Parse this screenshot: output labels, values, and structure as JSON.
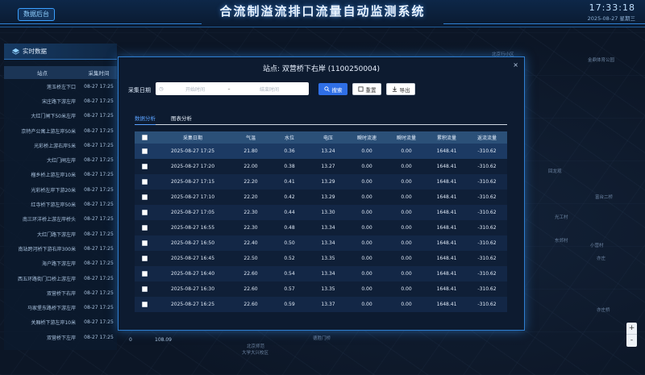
{
  "header": {
    "title": "合流制溢流排口流量自动监测系统",
    "back_label": "数据后台",
    "time": "17:33:18",
    "date": "2025-08-27 星期三"
  },
  "map_labels": [
    "金鼎体育公园",
    "北京体育",
    "大学木棉路",
    "北京师范",
    "大学大兴校区",
    "回龙观",
    "富台二桥",
    "光工村",
    "东郊村",
    "小营村",
    "亦庄",
    "亦庄桥",
    "北京行小区",
    "阳台中心",
    "德胜门桥"
  ],
  "realtime": {
    "title": "实时数据",
    "col_station": "站点",
    "col_time": "采集时间",
    "rows": [
      {
        "station": "莲玉桥左下口",
        "time": "08-27 17:25"
      },
      {
        "station": "宋庄路下游左岸",
        "time": "08-27 17:25"
      },
      {
        "station": "大红门闸下50米左岸",
        "time": "08-27 17:25"
      },
      {
        "station": "京特产公寓上游左岸50米",
        "time": "08-27 17:25"
      },
      {
        "station": "光彩桥上游右岸5米",
        "time": "08-27 17:25"
      },
      {
        "station": "大红门闸左岸",
        "time": "08-27 17:25"
      },
      {
        "station": "榴乡桥上游左岸10米",
        "time": "08-27 17:25"
      },
      {
        "station": "光彩桥左岸下游20米",
        "time": "08-27 17:25"
      },
      {
        "station": "红寺桥下游左岸50米",
        "time": "08-27 17:25"
      },
      {
        "station": "南三环洋桥上游左岸桥头",
        "time": "08-27 17:25"
      },
      {
        "station": "大红门路下游左岸",
        "time": "08-27 17:25"
      },
      {
        "station": "南站跨河桥下游右岸300米",
        "time": "08-27 17:25"
      },
      {
        "station": "海户路下游左岸",
        "time": "08-27 17:25"
      },
      {
        "station": "西五环路街门口桥上游左岸",
        "time": "08-27 17:25"
      },
      {
        "station": "双营桥下右岸",
        "time": "08-27 17:25"
      },
      {
        "station": "马家堡东路桥下游左岸",
        "time": "08-27 17:25"
      },
      {
        "station": "关厢桥下游左岸10米",
        "time": "08-27 17:25"
      },
      {
        "station": "双营桥下左岸",
        "time": "08-27 17:25"
      }
    ],
    "stray_values": [
      "0",
      "108.09"
    ]
  },
  "modal": {
    "title": "站点: 双营桥下右岸 (1100250004)",
    "close_glyph": "×",
    "filter_label": "采集日期",
    "start_placeholder": "开始时间",
    "range_sep": "–",
    "end_placeholder": "结束时间",
    "search_label": "搜索",
    "reset_label": "重置",
    "export_label": "导出",
    "tabs": [
      "数据分析",
      "图表分析"
    ],
    "columns": [
      "采集日期",
      "气温",
      "水位",
      "电压",
      "瞬时流速",
      "瞬时流量",
      "累积流量",
      "返流流量"
    ],
    "rows": [
      [
        "2025-08-27 17:25",
        "21.80",
        "0.36",
        "13.24",
        "0.00",
        "0.00",
        "1648.41",
        "-310.62"
      ],
      [
        "2025-08-27 17:20",
        "22.00",
        "0.38",
        "13.27",
        "0.00",
        "0.00",
        "1648.41",
        "-310.62"
      ],
      [
        "2025-08-27 17:15",
        "22.20",
        "0.41",
        "13.29",
        "0.00",
        "0.00",
        "1648.41",
        "-310.62"
      ],
      [
        "2025-08-27 17:10",
        "22.20",
        "0.42",
        "13.29",
        "0.00",
        "0.00",
        "1648.41",
        "-310.62"
      ],
      [
        "2025-08-27 17:05",
        "22.30",
        "0.44",
        "13.30",
        "0.00",
        "0.00",
        "1648.41",
        "-310.62"
      ],
      [
        "2025-08-27 16:55",
        "22.30",
        "0.48",
        "13.34",
        "0.00",
        "0.00",
        "1648.41",
        "-310.62"
      ],
      [
        "2025-08-27 16:50",
        "22.40",
        "0.50",
        "13.34",
        "0.00",
        "0.00",
        "1648.41",
        "-310.62"
      ],
      [
        "2025-08-27 16:45",
        "22.50",
        "0.52",
        "13.35",
        "0.00",
        "0.00",
        "1648.41",
        "-310.62"
      ],
      [
        "2025-08-27 16:40",
        "22.60",
        "0.54",
        "13.34",
        "0.00",
        "0.00",
        "1648.41",
        "-310.62"
      ],
      [
        "2025-08-27 16:30",
        "22.60",
        "0.57",
        "13.35",
        "0.00",
        "0.00",
        "1648.41",
        "-310.62"
      ],
      [
        "2025-08-27 16:25",
        "22.60",
        "0.59",
        "13.37",
        "0.00",
        "0.00",
        "1648.41",
        "-310.62"
      ]
    ]
  },
  "zoom": {
    "plus": "+",
    "minus": "-"
  },
  "colors": {
    "accent": "#2f6fe6",
    "border": "#2f7fd1",
    "background": "#0a1322"
  }
}
